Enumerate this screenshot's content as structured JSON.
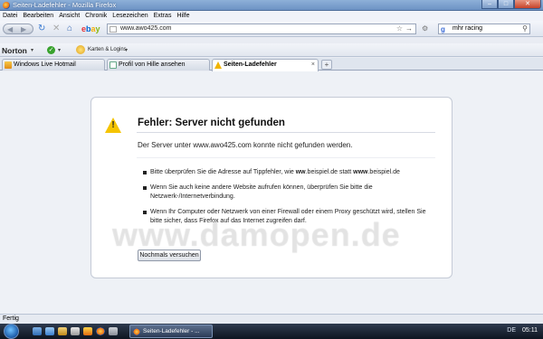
{
  "window": {
    "title": "Seiten-Ladefehler - Mozilla Firefox"
  },
  "menubar": {
    "items": [
      "Datei",
      "Bearbeiten",
      "Ansicht",
      "Chronik",
      "Lesezeichen",
      "Extras",
      "Hilfe"
    ]
  },
  "toolbar": {
    "url": "www.awo425.com",
    "search_value": "mhr racing"
  },
  "norton": {
    "logo": "Norton",
    "cards_label": "Karten & Logins"
  },
  "tabs": [
    {
      "label": "Windows Live Hotmail",
      "active": false
    },
    {
      "label": "Profil von Hille ansehen",
      "active": false
    },
    {
      "label": "Seiten-Ladefehler",
      "active": true
    }
  ],
  "error": {
    "title": "Fehler: Server nicht gefunden",
    "description": "Der Server unter www.awo425.com konnte nicht gefunden werden.",
    "items": [
      {
        "parts": [
          {
            "text": "Bitte überprüfen Sie die Adresse auf Tippfehler, wie "
          },
          {
            "text": "ww",
            "bold": true
          },
          {
            "text": ".beispiel.de statt "
          },
          {
            "text": "www",
            "bold": true
          },
          {
            "text": ".beispiel.de"
          }
        ]
      },
      {
        "parts": [
          {
            "text": "Wenn Sie auch keine andere Website aufrufen können, überprüfen Sie bitte die Netzwerk-/Internetverbindung."
          }
        ]
      },
      {
        "parts": [
          {
            "text": "Wenn Ihr Computer oder Netzwerk von einer Firewall oder einem Proxy geschützt wird, stellen Sie bitte sicher, dass Firefox auf das Internet zugreifen darf."
          }
        ]
      }
    ],
    "retry_label": "Nochmals versuchen"
  },
  "watermark": "www.damopen.de",
  "statusbar": {
    "text": "Fertig"
  },
  "taskbar": {
    "window_button": "Seiten-Ladefehler - ...",
    "tray_lang": "DE",
    "clock": "05:11"
  }
}
